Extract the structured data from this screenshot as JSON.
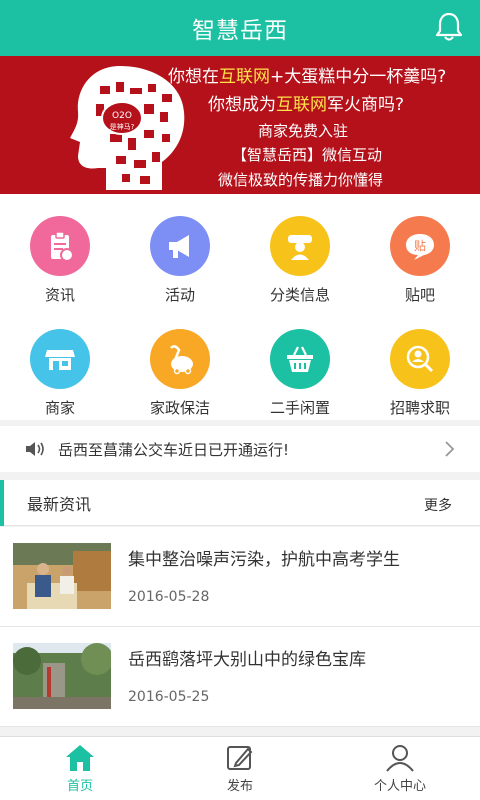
{
  "header": {
    "title": "智慧岳西",
    "icon": "bell-icon"
  },
  "banner": {
    "badge": "O2O 是神马?",
    "line1_pre": "你想在",
    "line1_hl": "互联网",
    "line1_post": "+大蛋糕中分一杯羹吗?",
    "line2_pre": "你想成为",
    "line2_hl": "互联网",
    "line2_post": "军火商吗?",
    "line3": "商家免费入驻",
    "line4": "【智慧岳西】微信互动",
    "line5": "微信极致的传播力你懂得",
    "colors": {
      "background": "#b4111a",
      "highlight": "#ffe24a"
    }
  },
  "grid": [
    {
      "label": "资讯",
      "icon": "news-clipboard-icon",
      "color": "#f0699a"
    },
    {
      "label": "活动",
      "icon": "megaphone-icon",
      "color": "#7d8ff5"
    },
    {
      "label": "分类信息",
      "icon": "category-person-icon",
      "color": "#f7c21a"
    },
    {
      "label": "贴吧",
      "icon": "speech-bubble-icon",
      "color": "#f57b4e"
    },
    {
      "label": "商家",
      "icon": "storefront-icon",
      "color": "#45c3e8"
    },
    {
      "label": "家政保洁",
      "icon": "vacuum-cleaner-icon",
      "color": "#f9a825"
    },
    {
      "label": "二手闲置",
      "icon": "basket-icon",
      "color": "#1cc0a2"
    },
    {
      "label": "招聘求职",
      "icon": "job-search-icon",
      "color": "#f7c21a"
    }
  ],
  "notice": {
    "text": "岳西至菖蒲公交车近日已开通运行!"
  },
  "news": {
    "title": "最新资讯",
    "more": "更多",
    "items": [
      {
        "title": "集中整治噪声污染，护航中高考学生",
        "date": "2016-05-28"
      },
      {
        "title": "岳西鹞落坪大别山中的绿色宝库",
        "date": "2016-05-25"
      }
    ]
  },
  "tabbar": [
    {
      "label": "首页",
      "icon": "home-icon",
      "active": true
    },
    {
      "label": "发布",
      "icon": "edit-icon",
      "active": false
    },
    {
      "label": "个人中心",
      "icon": "user-icon",
      "active": false
    }
  ],
  "accent": "#1cc0a2"
}
